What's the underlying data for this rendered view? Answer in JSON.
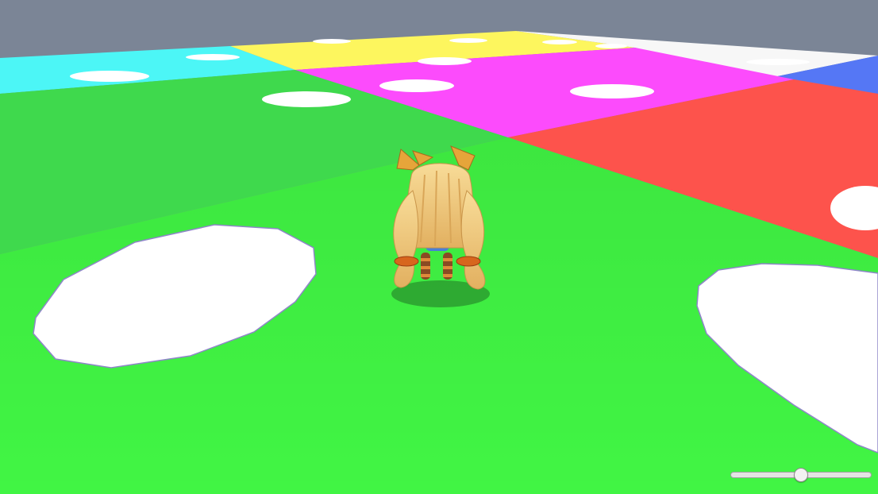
{
  "scene": {
    "sky_color": "#7b8596",
    "tiles": [
      {
        "name": "tile-cyan",
        "color": "#4cf6f6"
      },
      {
        "name": "tile-yellow",
        "color": "#fdf65e"
      },
      {
        "name": "tile-white",
        "color": "#f7f7f7"
      },
      {
        "name": "tile-dark-green",
        "color": "#3fd94d"
      },
      {
        "name": "tile-magenta",
        "color": "#fc4bfc"
      },
      {
        "name": "tile-blue",
        "color": "#5577f5"
      },
      {
        "name": "tile-red",
        "color": "#fd534c"
      },
      {
        "name": "tile-green",
        "color": "#41f544"
      }
    ],
    "spot_color": "#ffffff",
    "character": {
      "name": "blonde-twin-tail-character",
      "hair_color": "#f3cc7a",
      "ribbon_color": "#e6a53a",
      "stocking_color": "#8a4a23"
    }
  },
  "hud": {
    "slider": {
      "value": 0.5
    }
  }
}
